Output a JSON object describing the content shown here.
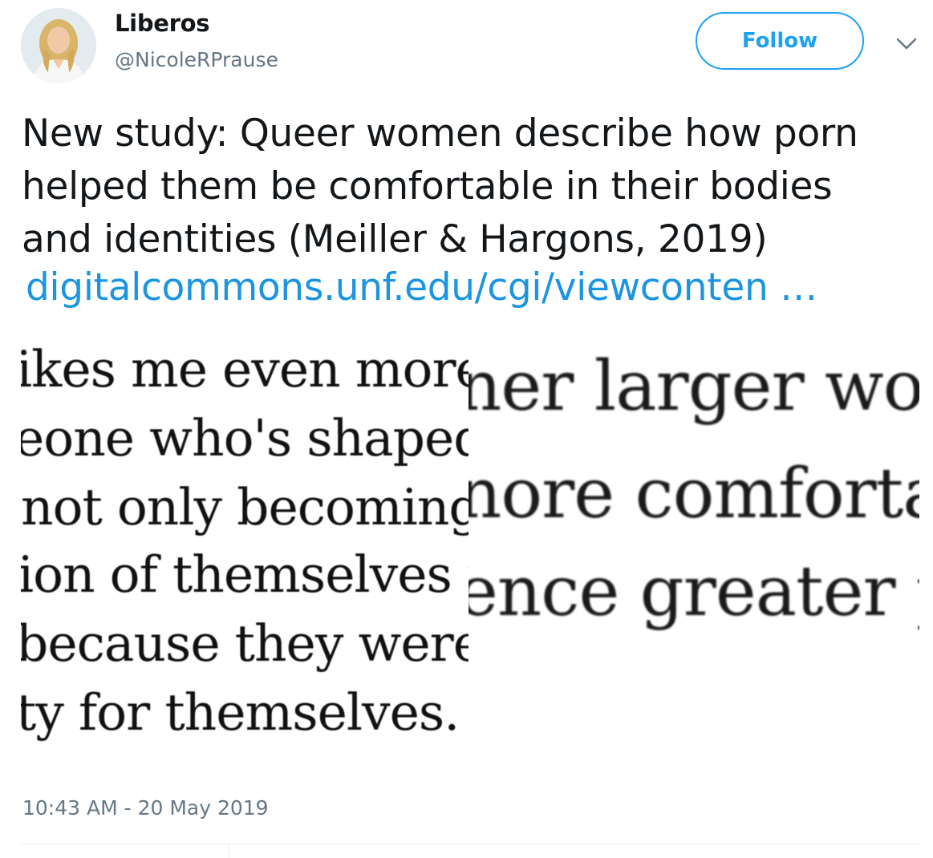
{
  "user": {
    "display_name": "Liberos",
    "handle": "@NicoleRPrause",
    "avatar_icon": "profile-photo"
  },
  "header": {
    "follow_label": "Follow",
    "menu_icon": "chevron-down-icon"
  },
  "tweet": {
    "text_lines": [
      "New study: Queer women describe how porn",
      "helped them be comfortable in their bodies",
      "and identities (Meiller & Hargons, 2019)"
    ],
    "link_text": "digitalcommons.unf.edu/cgi/viewconten …",
    "timestamp": "10:43 AM - 20 May 2019"
  },
  "media": {
    "left_lines": [
      "ikes me even more",
      "eone who's shaped l",
      "not only becoming r",
      "ion of themselves ir",
      " because they were",
      "ty for themselves. B"
    ],
    "right_lines": [
      "ner larger wor",
      "nore comforta",
      "ence greater p"
    ]
  },
  "colors": {
    "accent": "#1da1f2",
    "link": "#1b95e0",
    "secondary_text": "#657786",
    "primary_text": "#14171a"
  }
}
